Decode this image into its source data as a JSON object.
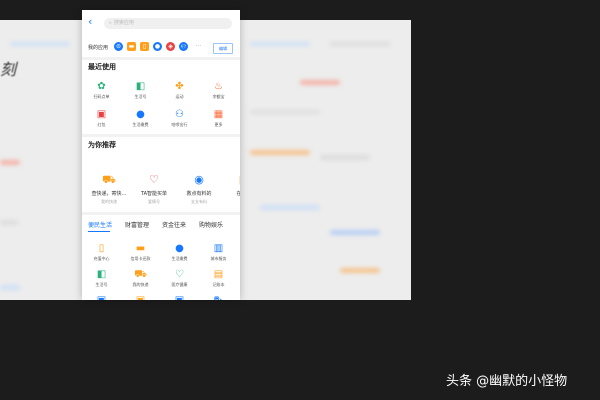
{
  "search": {
    "placeholder": "搜索应用"
  },
  "my_apps": {
    "label": "我的应用",
    "edit_label": "编辑",
    "more": "···"
  },
  "recent": {
    "title": "最近使用",
    "items": [
      {
        "label": "扫码点单",
        "icon": "qr-icon",
        "color": "#2ab27b",
        "glyph": "✿"
      },
      {
        "label": "生活号",
        "icon": "life-icon",
        "color": "#2ab27b",
        "glyph": "◧"
      },
      {
        "label": "运动",
        "icon": "sport-icon",
        "color": "#ff9f1a",
        "glyph": "✤"
      },
      {
        "label": "余额宝",
        "icon": "yuebao-icon",
        "color": "#f5621d",
        "glyph": "♨"
      },
      {
        "label": "红包",
        "icon": "redpacket-icon",
        "color": "#e94242",
        "glyph": "▣"
      },
      {
        "label": "生活缴费",
        "icon": "utility-icon",
        "color": "#1677ff",
        "glyph": "●"
      },
      {
        "label": "哈啰出行",
        "icon": "bike-icon",
        "color": "#1677ff",
        "glyph": "⚇"
      },
      {
        "label": "更多",
        "icon": "more-icon",
        "color": "#ff6a3d",
        "glyph": "▦"
      }
    ]
  },
  "recommend": {
    "title": "为你推荐",
    "items": [
      {
        "title": "查快递，寄快…",
        "sub": "我的快递",
        "icon": "delivery-icon",
        "color": "#ff9f1a",
        "glyph": "⛟"
      },
      {
        "title": "TA智能买单",
        "sub": "爱情号",
        "icon": "heart-icon",
        "color": "#e94242",
        "glyph": "♡"
      },
      {
        "title": "救点有料的",
        "sub": "支支有料",
        "icon": "eye-icon",
        "color": "#1677ff",
        "glyph": "◉"
      },
      {
        "title": "在线市",
        "sub": "",
        "icon": "market-icon",
        "color": "#ff9f1a",
        "glyph": "▩"
      }
    ]
  },
  "tabs": [
    "便民生活",
    "财富管理",
    "资金往来",
    "购物娱乐"
  ],
  "convenience": {
    "items": [
      {
        "label": "充值中心",
        "icon": "phone-icon",
        "color": "#ff9f1a",
        "glyph": "▯"
      },
      {
        "label": "信用卡还款",
        "icon": "card-icon",
        "color": "#ff9f1a",
        "glyph": "▬"
      },
      {
        "label": "生活缴费",
        "icon": "utility-icon",
        "color": "#1677ff",
        "glyph": "●"
      },
      {
        "label": "城市服务",
        "icon": "city-icon",
        "color": "#1677ff",
        "glyph": "▥"
      },
      {
        "label": "生活号",
        "icon": "life-icon",
        "color": "#2ab27b",
        "glyph": "◧"
      },
      {
        "label": "我的快递",
        "icon": "delivery-icon",
        "color": "#ff9f1a",
        "glyph": "⛟"
      },
      {
        "label": "医疗健康",
        "icon": "health-icon",
        "color": "#2ab27b",
        "glyph": "♡"
      },
      {
        "label": "记账本",
        "icon": "ledger-icon",
        "color": "#ff9f1a",
        "glyph": "▤"
      },
      {
        "label": "",
        "icon": "app-icon",
        "color": "#1677ff",
        "glyph": "▣"
      },
      {
        "label": "",
        "icon": "app-icon",
        "color": "#ff9f1a",
        "glyph": "▣"
      },
      {
        "label": "",
        "icon": "app-icon",
        "color": "#1677ff",
        "glyph": "▣"
      },
      {
        "label": "",
        "icon": "car-icon",
        "color": "#1677ff",
        "glyph": "⛍"
      }
    ]
  },
  "watermark": "头条 @幽默的小怪物"
}
